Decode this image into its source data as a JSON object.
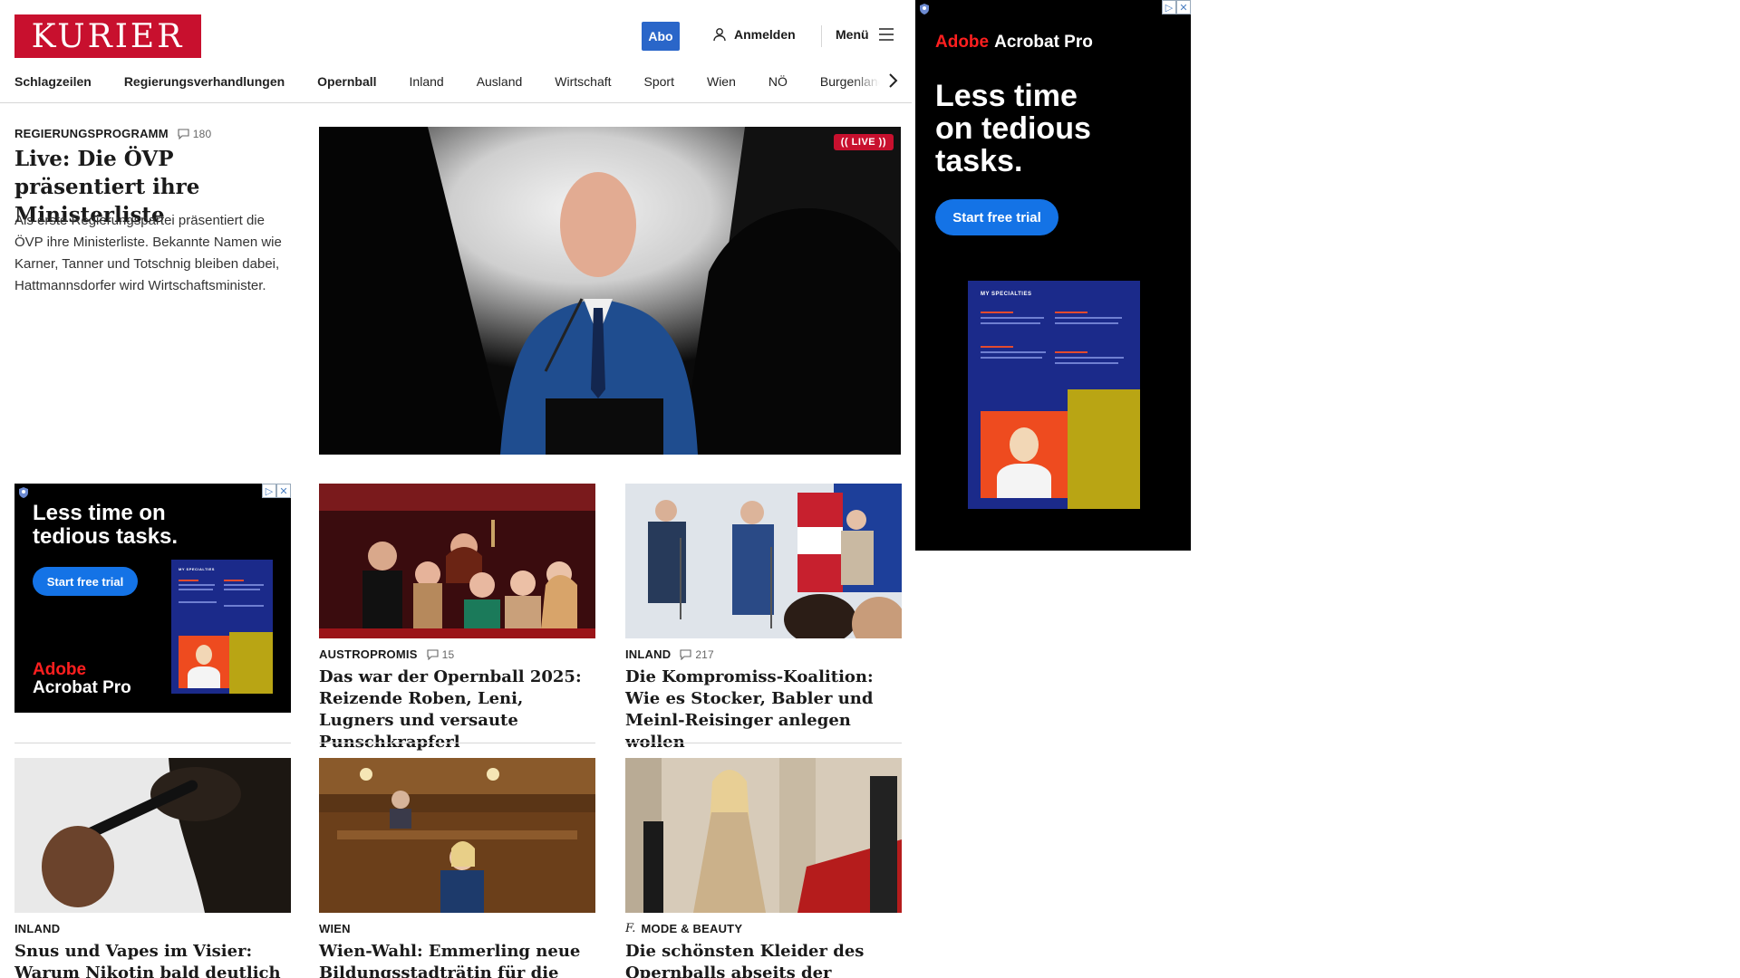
{
  "header": {
    "logo": "KURIER",
    "abo_label": "Abo",
    "login_label": "Anmelden",
    "menu_label": "Menü"
  },
  "nav": {
    "items": [
      "Schlagzeilen",
      "Regierungsverhandlungen",
      "Opernball",
      "Inland",
      "Ausland",
      "Wirtschaft",
      "Sport",
      "Wien",
      "NÖ",
      "Burgenland"
    ]
  },
  "top_story": {
    "kicker": "REGIERUNGSPROGRAMM",
    "comments": "180",
    "title": "Live: Die ÖVP präsentiert ihre Ministerliste",
    "lead": "Als erste Regierungspartei präsentiert die ÖVP ihre Ministerliste. Bekannte Namen wie Karner, Tanner und Totschnig bleiben dabei, Hattmannsdorfer wird Wirtschaftsminister.",
    "live_label": "(( LIVE ))"
  },
  "side_ad": {
    "brand": "Adobe",
    "product": "Acrobat Pro",
    "headline_lines": [
      "Less time",
      "on tedious",
      "tasks."
    ],
    "cta": "Start free trial",
    "mock_title": "MY SPECIALTIES"
  },
  "inline_ad": {
    "headline_lines": [
      "Less time on",
      "tedious tasks."
    ],
    "cta": "Start free trial",
    "brand": "Adobe",
    "product": "Acrobat Pro",
    "mock_title": "MY SPECIALTIES"
  },
  "articles": [
    {
      "kicker": "AUSTROPROMIS",
      "comments": "15",
      "title": "Das war der Opernball 2025: Reizende Roben, Leni, Lugners und versaute Punschkrapferl"
    },
    {
      "kicker": "INLAND",
      "comments": "217",
      "title": "Die Kompromiss-Koalition: Wie es Stocker, Babler und Meinl-Reisinger anlegen wollen"
    },
    {
      "kicker": "INLAND",
      "comments": "",
      "title": "Snus und Vapes im Visier: Warum Nikotin bald deutlich teurer wird"
    },
    {
      "kicker": "WIEN",
      "comments": "",
      "title": "Wien-Wahl: Emmerling neue Bildungsstadträtin für die Neos"
    },
    {
      "kicker": "MODE & BEAUTY",
      "comments": "",
      "title": "Die schönsten Kleider des Opernballs abseits der Kameras"
    }
  ],
  "colors": {
    "brand_red": "#c8102e",
    "abo_blue": "#2a66c9",
    "adobe_red": "#ff1f1f",
    "cta_blue": "#1473e6"
  }
}
